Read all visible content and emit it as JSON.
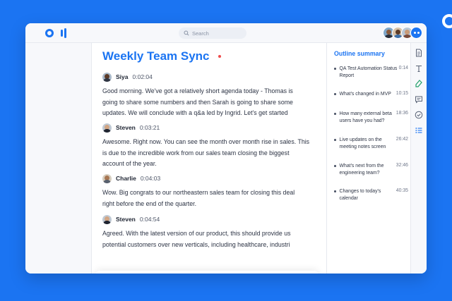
{
  "app": {
    "search_placeholder": "Search"
  },
  "colors": {
    "accent": "#1b74f2",
    "recording_dot": "#ef4b4b"
  },
  "meeting": {
    "title": "Weekly Team Sync"
  },
  "transcript": [
    {
      "speaker": "Siya",
      "time": "0:02:04",
      "lines": [
        "Good morning. We've got a relatively short agenda today - Thomas is",
        "going to share some numbers and then Sarah is going to share some",
        "updates. We will conclude with a q&a led by Ingrid. Let's get started"
      ]
    },
    {
      "speaker": "Steven",
      "time": "0:03:21",
      "lines": [
        "Awesome. Right now. You can see the month over month rise in sales. This",
        "is due to the incredible work from our sales team closing the biggest",
        "account of the year."
      ]
    },
    {
      "speaker": "Charlie",
      "time": "0:04:03",
      "lines": [
        "Wow. Big congrats to our northeastern sales team for closing this deal",
        "right before the end of the quarter."
      ]
    },
    {
      "speaker": "Steven",
      "time": "0:04:54",
      "lines": [
        "Agreed. With the latest version of our product, this should provide us",
        "potential customers over new verticals, including healthcare, industri"
      ]
    }
  ],
  "outline": {
    "title": "Outline summary",
    "items": [
      {
        "text": "QA Test Automation Status Report",
        "time": "0:14"
      },
      {
        "text": "What's changed in MVP",
        "time": "10:15"
      },
      {
        "text": "How many external beta users have you had?",
        "time": "18:36"
      },
      {
        "text": "Live updates on the meeting notes screen",
        "time": "26:42"
      },
      {
        "text": "What's next from the engineering team?",
        "time": "32:46"
      },
      {
        "text": "Changes to today's calendar",
        "time": "40:35"
      }
    ]
  },
  "icons": {
    "search": "search-icon",
    "right_rail": [
      "document-icon",
      "text-icon",
      "highlight-icon",
      "comment-icon",
      "check-circle-icon",
      "list-icon"
    ],
    "toolbar": [
      "highlight-icon",
      "comment-icon",
      "check-circle-icon",
      "image-icon"
    ],
    "capture": "screenshot-capture-icon"
  }
}
